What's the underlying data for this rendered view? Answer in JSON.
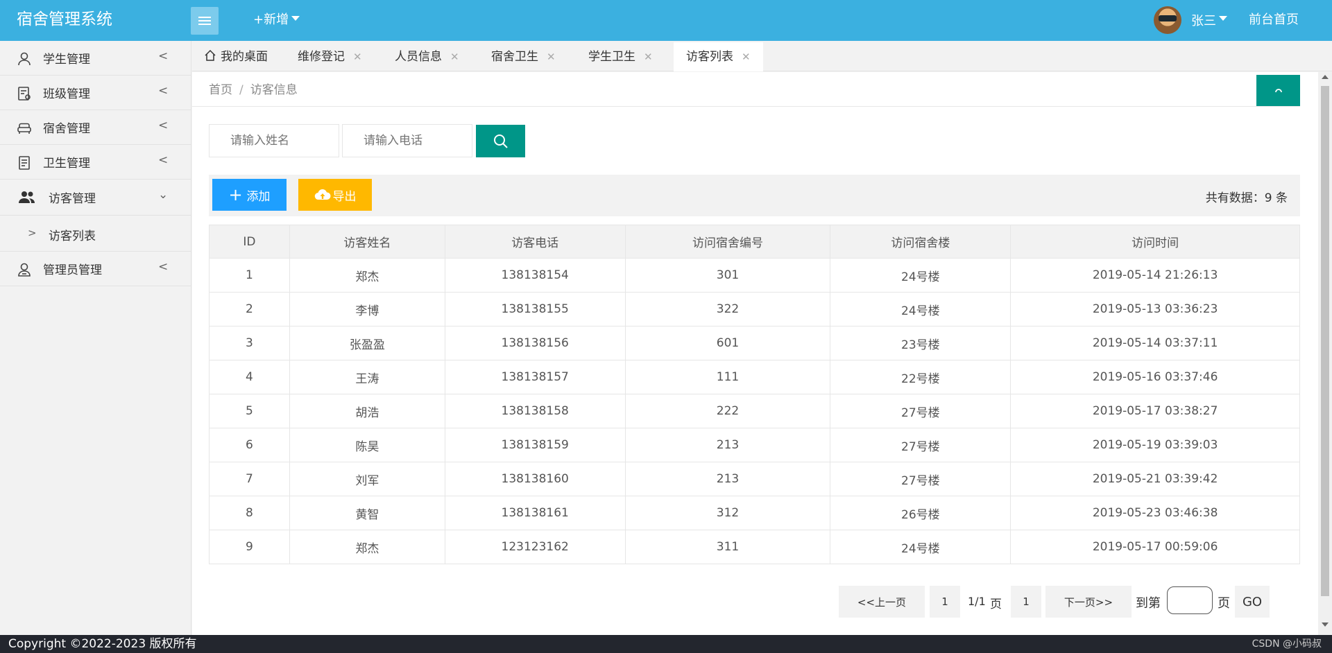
{
  "header": {
    "logo": "宿舍管理系统",
    "add_new": "+新增",
    "user_name": "张三",
    "front_page": "前台首页"
  },
  "sidebar": {
    "items": [
      {
        "label": "学生管理",
        "icon": "user-icon"
      },
      {
        "label": "班级管理",
        "icon": "class-icon"
      },
      {
        "label": "宿舍管理",
        "icon": "sofa-icon"
      },
      {
        "label": "卫生管理",
        "icon": "notepad-icon"
      },
      {
        "label": "访客管理",
        "icon": "users-icon"
      },
      {
        "label": "管理员管理",
        "icon": "admin-icon"
      }
    ],
    "sub_item": "访客列表"
  },
  "tabs": [
    {
      "label": "我的桌面"
    },
    {
      "label": "维修登记"
    },
    {
      "label": "人员信息"
    },
    {
      "label": "宿舍卫生"
    },
    {
      "label": "学生卫生"
    },
    {
      "label": "访客列表"
    }
  ],
  "breadcrumb": {
    "home": "首页",
    "current": "访客信息"
  },
  "search": {
    "name_placeholder": "请输入姓名",
    "phone_placeholder": "请输入电话"
  },
  "toolbar": {
    "add_label": "添加",
    "export_label": "导出",
    "total_text": "共有数据：9 条"
  },
  "table": {
    "headers": [
      "ID",
      "访客姓名",
      "访客电话",
      "访问宿舍编号",
      "访问宿舍楼",
      "访问时间"
    ],
    "rows": [
      [
        "1",
        "郑杰",
        "138138154",
        "301",
        "24号楼",
        "2019-05-14 21:26:13"
      ],
      [
        "2",
        "李博",
        "138138155",
        "322",
        "24号楼",
        "2019-05-13 03:36:23"
      ],
      [
        "3",
        "张盈盈",
        "138138156",
        "601",
        "23号楼",
        "2019-05-14 03:37:11"
      ],
      [
        "4",
        "王涛",
        "138138157",
        "111",
        "22号楼",
        "2019-05-16 03:37:46"
      ],
      [
        "5",
        "胡浩",
        "138138158",
        "222",
        "27号楼",
        "2019-05-17 03:38:27"
      ],
      [
        "6",
        "陈昊",
        "138138159",
        "213",
        "27号楼",
        "2019-05-19 03:39:03"
      ],
      [
        "7",
        "刘军",
        "138138160",
        "213",
        "27号楼",
        "2019-05-21 03:39:42"
      ],
      [
        "8",
        "黄智",
        "138138161",
        "312",
        "26号楼",
        "2019-05-23 03:46:38"
      ],
      [
        "9",
        "郑杰",
        "123123162",
        "311",
        "24号楼",
        "2019-05-17 00:59:06"
      ]
    ]
  },
  "pagination": {
    "prev": "<<上一页",
    "first_page": "1",
    "page_info": "1/1",
    "page_unit": "页",
    "current_page": "1",
    "next": "下一页>>",
    "goto_label": "到第",
    "goto_unit": "页",
    "go": "GO"
  },
  "footer": {
    "copyright": "Copyright ©2022-2023 版权所有",
    "watermark": "CSDN @小码叔"
  },
  "colors": {
    "header_bg": "#3bb0e0",
    "primary_teal": "#009688",
    "add_blue": "#1e9fff",
    "export_yellow": "#ffb800",
    "footer_bg": "#23262e"
  }
}
